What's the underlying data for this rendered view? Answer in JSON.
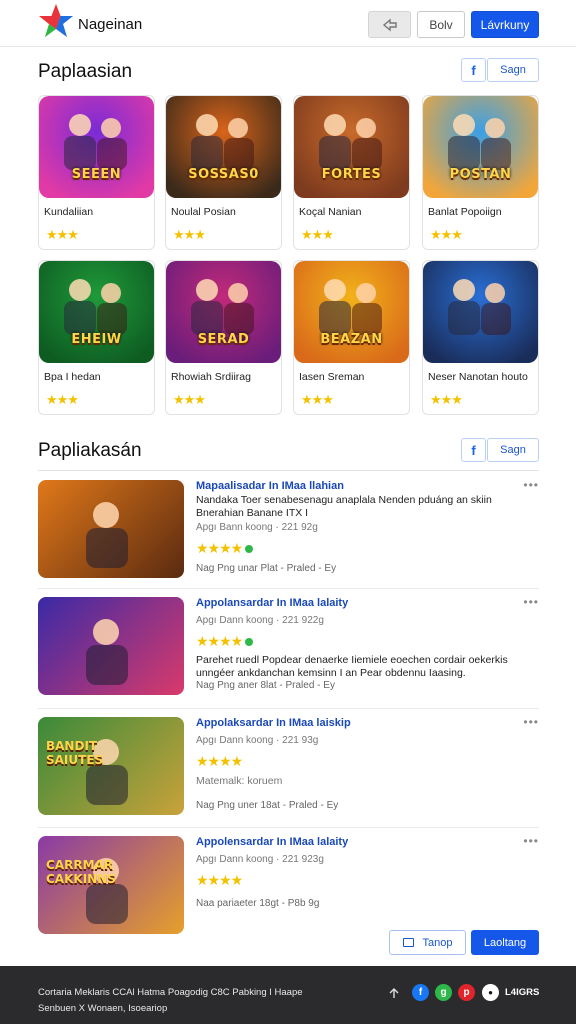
{
  "header": {
    "brand": "Nageinan",
    "icon_button": "share-icon",
    "ghost_label": "Bolv",
    "primary_label": "Lávrkuny"
  },
  "section1": {
    "title": "Paplaasian",
    "fb_label": "f",
    "sign_label": "Sagn"
  },
  "cards": [
    {
      "name": "Kundaliian",
      "art_text": "SEEEN",
      "rating": 3,
      "palette": [
        "#7a2bd6",
        "#e23aa5"
      ]
    },
    {
      "name": "Noulal Posian",
      "art_text": "SOSSAS0",
      "rating": 3,
      "palette": [
        "#d9641a",
        "#3b2a1a"
      ]
    },
    {
      "name": "Koçal Nanian",
      "art_text": "FORTES",
      "rating": 3,
      "palette": [
        "#c86a2a",
        "#7d3a1e"
      ]
    },
    {
      "name": "Banlat Popoiign",
      "art_text": "POSTAN",
      "rating": 3,
      "palette": [
        "#3aa0e6",
        "#f2a63a"
      ]
    },
    {
      "name": "Bpa I hedan",
      "art_text": "EHEIW",
      "rating": 3,
      "palette": [
        "#1f9a3a",
        "#0e5c22"
      ]
    },
    {
      "name": "Rhowiah Srdiirag",
      "art_text": "SERAD",
      "rating": 3,
      "palette": [
        "#c22a7a",
        "#6a1d7a"
      ]
    },
    {
      "name": "Iasen Sreman",
      "art_text": "BEAZAN",
      "rating": 3,
      "palette": [
        "#f2b21a",
        "#d96a1a"
      ]
    },
    {
      "name": "Neser Nanotan houto",
      "art_text": "",
      "rating": 3,
      "palette": [
        "#2a6fd6",
        "#1a2d5a"
      ]
    }
  ],
  "section2": {
    "title": "Papliakasán",
    "fb_label": "f",
    "sign_label": "Sagn"
  },
  "list": [
    {
      "title": "Mapaalisadar In IMaa llahian",
      "description": "Nandaka Toer senabesenagu anaplala Nenden pduáng an skiin Bnerahian Banane ITX I",
      "meta": "Apgı Bann koong · 221 92g",
      "rating": 4,
      "verified": true,
      "footer": "Nag Png unar Plat - Praled - Ey",
      "art_text": "",
      "palette": [
        "#e0781a",
        "#5a2a10"
      ]
    },
    {
      "title": "Appolansardar In IMaa lalaity",
      "description": "Parehet ruedl Popdear denaerke Iiemiele eoechen cordair oekerkis unngéer ankdanchan kemsinn I an Pear obdennu Iaasing.",
      "meta": "Apgı Dann koong · 221 922g",
      "rating": 4,
      "verified": true,
      "footer": "Nag Png aner 8lat - Praled - Ey",
      "art_text": "",
      "palette": [
        "#3a2aa6",
        "#d93a6a"
      ]
    },
    {
      "title": "Appolaksardar In IMaa laiskip",
      "description": "Matemalk: koruem",
      "meta": "Apgı Dann koong · 221 93g",
      "rating": 4,
      "verified": false,
      "footer": "Nag Png uner 18at - Praled - Ey",
      "art_text": "BANDIT SAIUTES",
      "palette": [
        "#3a8a3a",
        "#c9a23a"
      ]
    },
    {
      "title": "Appolensardar In IMaa lalaity",
      "description": "",
      "meta": "Apgı Dann koong · 221 923g",
      "rating": 4,
      "verified": false,
      "footer": "Naa pariaeter 18gt - P8b 9g",
      "art_text": "CARRMAR CAKKINNS",
      "palette": [
        "#8a3aa6",
        "#e6a02a"
      ]
    }
  ],
  "actions": {
    "ghost_label": "Tanop",
    "primary_label": "Laoltang"
  },
  "footer": {
    "text": "Cortaria Meklaris CCAl Hatma  Poagodig  C8C Pabking I Haape Senbuen X Wonaen, Isoeariop",
    "label": "L4IGRS",
    "icons": [
      "upload-icon",
      "facebook-icon",
      "google-icon",
      "pinterest-icon",
      "brand-icon"
    ]
  },
  "colors": {
    "primary": "#1557e8",
    "star": "#f2c200",
    "link": "#1a49b8",
    "footer_bg": "#2b2b2d"
  }
}
